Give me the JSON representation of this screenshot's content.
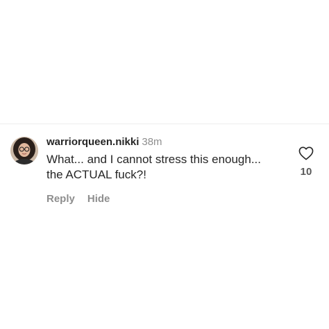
{
  "comment": {
    "username": "warriorqueen.nikki",
    "timestamp": "38m",
    "text_line1": "What... and I cannot stress this enough...",
    "text_line2": "the ACTUAL fuck?!",
    "reply_label": "Reply",
    "hide_label": "Hide",
    "like_count": "10",
    "avatar_icon": "user-avatar",
    "like_icon": "heart-outline-icon"
  },
  "colors": {
    "text_primary": "#262626",
    "text_secondary": "#8e8e8e",
    "divider": "#ececec",
    "background": "#ffffff"
  }
}
